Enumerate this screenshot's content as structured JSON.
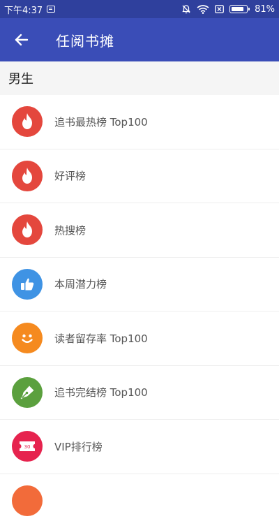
{
  "status_bar": {
    "time": "下午4:37",
    "battery": "81%",
    "icons": [
      "message-icon",
      "bell-off-icon",
      "wifi-icon",
      "sim-off-icon",
      "battery-icon"
    ]
  },
  "app_bar": {
    "title": "任阅书摊",
    "back_icon": "arrow-left-icon"
  },
  "section": {
    "title": "男生"
  },
  "rankings": [
    {
      "label": "追书最热榜 Top100",
      "icon": "flame-icon",
      "color": "#e4473d"
    },
    {
      "label": "好评榜",
      "icon": "flame-icon",
      "color": "#e4473d"
    },
    {
      "label": "热搜榜",
      "icon": "flame-icon",
      "color": "#e4473d"
    },
    {
      "label": "本周潜力榜",
      "icon": "thumbs-up-icon",
      "color": "#3f93e4"
    },
    {
      "label": "读者留存率 Top100",
      "icon": "smile-icon",
      "color": "#f58a1f"
    },
    {
      "label": "追书完结榜 Top100",
      "icon": "pen-nib-icon",
      "color": "#5ba03e"
    },
    {
      "label": "VIP排行榜",
      "icon": "ticket-icon",
      "color": "#e6234e"
    }
  ],
  "colors": {
    "status_bar": "#2f409d",
    "app_bar": "#3a4db7",
    "section_bg": "#f5f5f5"
  }
}
